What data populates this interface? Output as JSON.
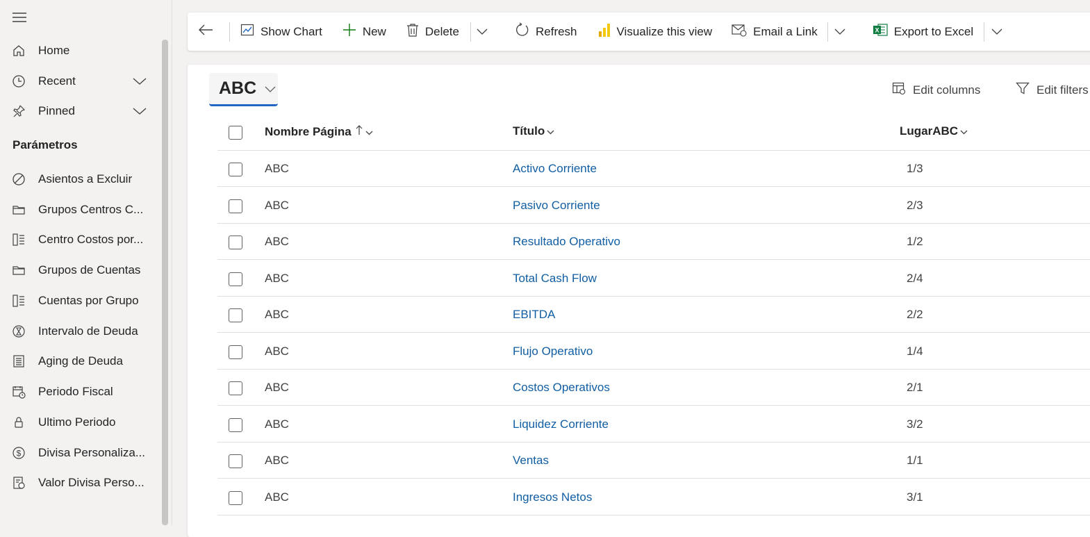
{
  "sidebar": {
    "nav": [
      {
        "label": "Home",
        "icon": "home-icon"
      },
      {
        "label": "Recent",
        "icon": "clock-icon"
      },
      {
        "label": "Pinned",
        "icon": "pin-icon"
      }
    ],
    "section_title": "Parámetros",
    "items": [
      {
        "label": "Asientos a Excluir",
        "icon": "prohibited-icon"
      },
      {
        "label": "Grupos Centros C...",
        "icon": "folder-icon"
      },
      {
        "label": "Centro Costos por...",
        "icon": "list-panel-icon"
      },
      {
        "label": "Grupos de Cuentas",
        "icon": "folder-icon"
      },
      {
        "label": "Cuentas por Grupo",
        "icon": "list-panel-icon"
      },
      {
        "label": "Intervalo de Deuda",
        "icon": "hourglass-icon"
      },
      {
        "label": "Aging de Deuda",
        "icon": "document-list-icon"
      },
      {
        "label": "Periodo Fiscal",
        "icon": "calendar-clock-icon"
      },
      {
        "label": "Ultimo Periodo",
        "icon": "lock-icon"
      },
      {
        "label": "Divisa Personaliza...",
        "icon": "currency-icon"
      },
      {
        "label": "Valor Divisa Perso...",
        "icon": "receipt-money-icon"
      }
    ]
  },
  "toolbar": {
    "show_chart": "Show Chart",
    "new": "New",
    "delete": "Delete",
    "refresh": "Refresh",
    "visualize": "Visualize this view",
    "email": "Email a Link",
    "export": "Export to Excel"
  },
  "view": {
    "name": "ABC",
    "edit_columns": "Edit columns",
    "edit_filters": "Edit filters"
  },
  "grid": {
    "columns": [
      "Nombre Página",
      "Título",
      "LugarABC"
    ],
    "rows": [
      {
        "nombre": "ABC",
        "titulo": "Activo Corriente",
        "lugar": "1/3"
      },
      {
        "nombre": "ABC",
        "titulo": "Pasivo Corriente",
        "lugar": "2/3"
      },
      {
        "nombre": "ABC",
        "titulo": "Resultado Operativo",
        "lugar": "1/2"
      },
      {
        "nombre": "ABC",
        "titulo": "Total Cash Flow",
        "lugar": "2/4"
      },
      {
        "nombre": "ABC",
        "titulo": "EBITDA",
        "lugar": "2/2"
      },
      {
        "nombre": "ABC",
        "titulo": "Flujo Operativo",
        "lugar": "1/4"
      },
      {
        "nombre": "ABC",
        "titulo": "Costos Operativos",
        "lugar": "2/1"
      },
      {
        "nombre": "ABC",
        "titulo": "Liquidez Corriente",
        "lugar": "3/2"
      },
      {
        "nombre": "ABC",
        "titulo": "Ventas",
        "lugar": "1/1"
      },
      {
        "nombre": "ABC",
        "titulo": "Ingresos Netos",
        "lugar": "3/1"
      }
    ]
  },
  "colors": {
    "link": "#115ea3",
    "accent": "#2266c2",
    "excel_green": "#107c41",
    "new_green": "#0f7b0f",
    "powerbi_yellow": "#f2c811"
  }
}
